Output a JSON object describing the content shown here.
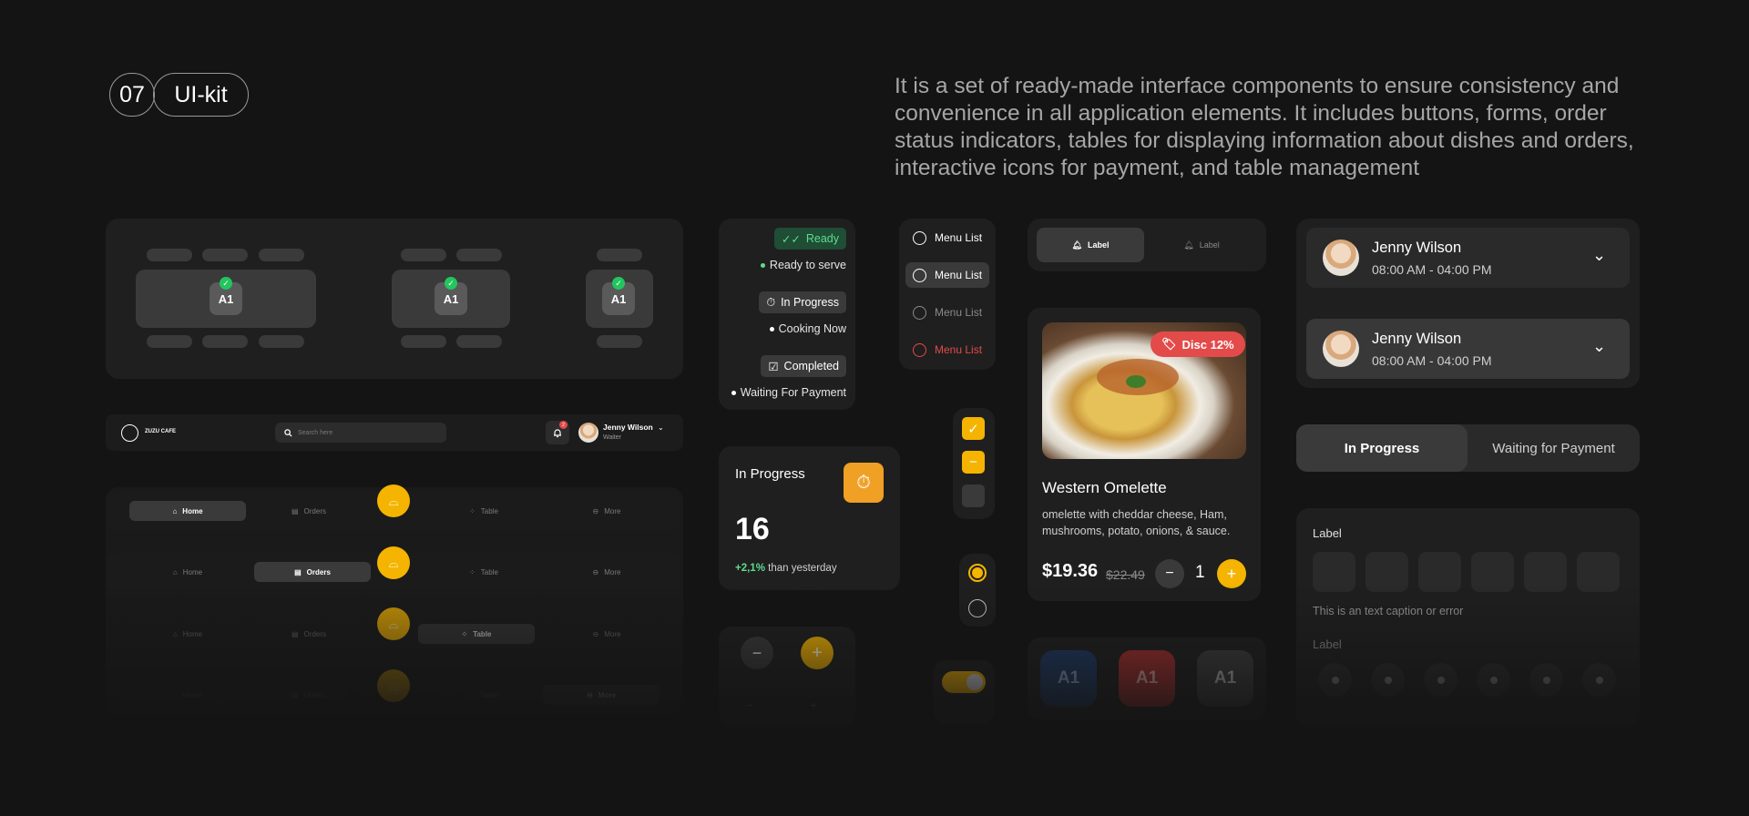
{
  "header": {
    "number": "07",
    "title": "UI-kit",
    "description": "It is a set of ready-made interface components to ensure consistency and convenience in all application elements. It includes buttons, forms, order status indicators, tables for displaying information about dishes and orders, interactive icons for payment, and table management"
  },
  "tables": {
    "seat_label": "A1"
  },
  "topbar": {
    "brand": "ZUZU CAFE",
    "search_placeholder": "Search here",
    "notification_count": "2",
    "user_name": "Jenny Wilson",
    "user_role": "Waiter"
  },
  "nav": {
    "items": [
      "Home",
      "Orders",
      "Table",
      "More"
    ]
  },
  "status": {
    "ready_badge": "Ready",
    "ready_text": "Ready to serve",
    "progress_badge": "In Progress",
    "progress_text": "Cooking Now",
    "completed_badge": "Completed",
    "completed_text": "Waiting For Payment"
  },
  "stats": {
    "title": "In Progress",
    "value": "16",
    "delta": "+2,1%",
    "delta_suffix": "than yesterday"
  },
  "menu_list": {
    "items": [
      "Menu List",
      "Menu List",
      "Menu List",
      "Menu List"
    ]
  },
  "label_tabs": {
    "active": "Label",
    "inactive": "Label"
  },
  "dish": {
    "discount": "Disc 12%",
    "name": "Western Omelette",
    "description": "omelette with cheddar cheese, Ham, mushrooms, potato, onions, & sauce.",
    "price": "$19.36",
    "old_price": "$22.49",
    "quantity": "1"
  },
  "chips": {
    "label": "A1"
  },
  "people": [
    {
      "name": "Jenny Wilson",
      "time": "08:00 AM - 04:00 PM"
    },
    {
      "name": "Jenny Wilson",
      "time": "08:00 AM - 04:00 PM"
    }
  ],
  "segment": {
    "active": "In Progress",
    "inactive": "Waiting for Payment"
  },
  "form": {
    "label1": "Label",
    "caption": "This is an text caption or error",
    "label2": "Label"
  },
  "colors": {
    "accent": "#f5b400",
    "success": "#22c55e",
    "danger": "#e34a4a",
    "orange": "#f0a024"
  }
}
